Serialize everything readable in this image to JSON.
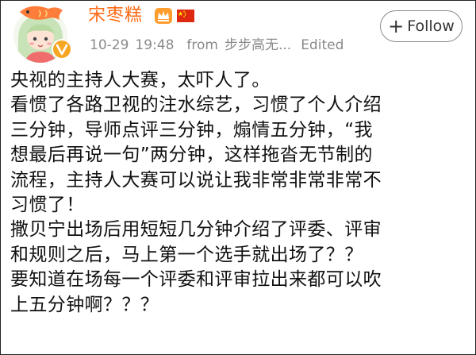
{
  "post": {
    "username": "宋枣糕",
    "date": "10-29",
    "time": "19:48",
    "from_label": "from",
    "source": "步步高无...",
    "edited_label": "Edited",
    "follow_label": "Follow",
    "follow_icon": "plus-icon",
    "badges": [
      "vip-crown-icon",
      "china-flag-icon",
      "verified-v-icon"
    ],
    "lines": [
      "央视的主持人大赛，太吓人了。",
      "看惯了各路卫视的注水综艺，习惯了个人介绍",
      "三分钟，导师点评三分钟，煽情五分钟，“我",
      "想最后再说一句”两分钟，这样拖沓无节制的",
      "流程，主持人大赛可以说让我非常非常非常不",
      "习惯了！",
      "撒贝宁出场后用短短几分钟介绍了评委、评审",
      "和规则之后，马上第一个选手就出场了？？",
      "要知道在场每一个评委和评审拉出来都可以吹",
      "上五分钟啊？？？"
    ]
  },
  "colors": {
    "username": "#ff6a13",
    "meta": "#8a8a8a",
    "text": "#111111",
    "verified_badge": "#f5a623",
    "flag_red": "#de2910",
    "flag_star": "#ffde00"
  }
}
